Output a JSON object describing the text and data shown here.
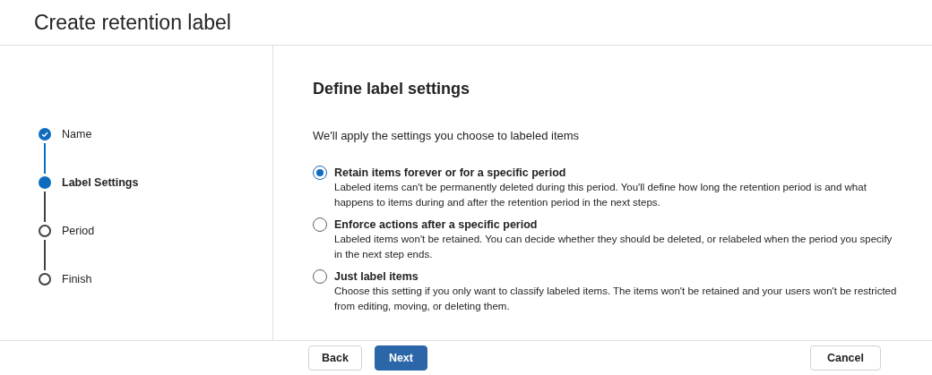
{
  "window": {
    "title": "Create retention label"
  },
  "steps": [
    {
      "label": "Name",
      "completed": true,
      "selected": false
    },
    {
      "label": "Label Settings",
      "completed": false,
      "selected": true
    },
    {
      "label": "Period",
      "completed": false,
      "selected": false
    },
    {
      "label": "Finish",
      "completed": false,
      "selected": false
    }
  ],
  "heading": "Define label settings",
  "intro": "We'll apply the settings you choose to labeled items",
  "options": [
    {
      "title": "Retain items forever or for a specific period",
      "description": "Labeled items can't be permanently deleted during this period. You'll define how long the retention period is and what happens to items during and after the retention period in the next steps.",
      "selected": true
    },
    {
      "title": "Enforce actions after a specific period",
      "description": "Labeled items won't be retained. You can decide whether they should be deleted, or relabeled when the period you specify in the next step ends.",
      "selected": false
    },
    {
      "title": "Just label items",
      "description": "Choose this setting if you only want to classify labeled items. The items won't be retained and your users won't be restricted from editing, moving, or deleting them.",
      "selected": false
    }
  ],
  "footer": {
    "back": "Back",
    "next": "Next",
    "cancel": "Cancel"
  }
}
